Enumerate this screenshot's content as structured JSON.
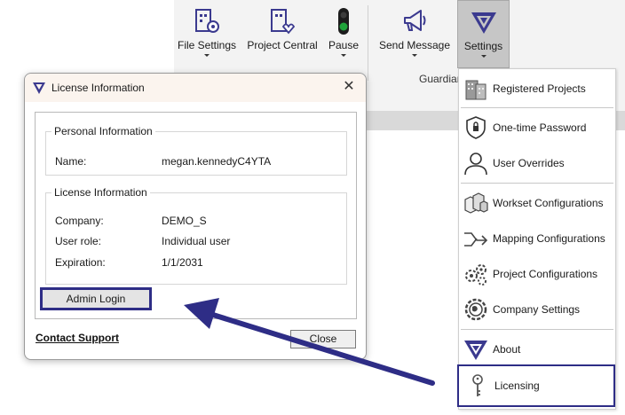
{
  "ribbon": {
    "buttons": {
      "file_settings": "File Settings",
      "project_central": "Project Central",
      "pause": "Pause",
      "send_message": "Send Message",
      "settings": "Settings"
    },
    "group_label": "Guardian"
  },
  "menu": {
    "items": [
      {
        "label": "Registered Projects",
        "icon": "building-icon"
      },
      {
        "label": "One-time Password",
        "icon": "shield-lock-icon"
      },
      {
        "label": "User Overrides",
        "icon": "user-icon"
      },
      {
        "label": "Workset Configurations",
        "icon": "blocks-icon"
      },
      {
        "label": "Mapping Configurations",
        "icon": "mapping-arrows-icon"
      },
      {
        "label": "Project Configurations",
        "icon": "gears-icon"
      },
      {
        "label": "Company Settings",
        "icon": "globe-gear-icon"
      },
      {
        "label": "About",
        "icon": "logo-icon"
      },
      {
        "label": "Licensing",
        "icon": "key-icon"
      }
    ]
  },
  "dialog": {
    "title": "License Information",
    "personal": {
      "legend": "Personal Information",
      "name_label": "Name:",
      "name_value": "megan.kennedyC4YTA"
    },
    "license": {
      "legend": "License Information",
      "company_label": "Company:",
      "company_value": "DEMO_S",
      "role_label": "User role:",
      "role_value": "Individual user",
      "expiration_label": "Expiration:",
      "expiration_value": "1/1/2031"
    },
    "admin_login": "Admin Login",
    "contact_support": "Contact Support",
    "close": "Close"
  },
  "colors": {
    "highlight": "#2e2d86",
    "brand": "#3b3a8f",
    "pause_green": "#1fa33a"
  }
}
